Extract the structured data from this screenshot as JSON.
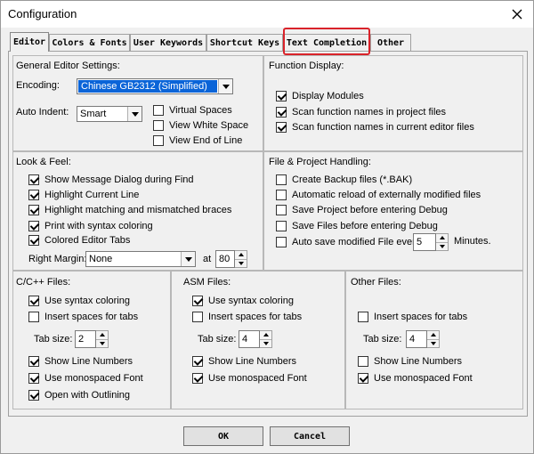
{
  "window": {
    "title": "Configuration"
  },
  "tabs": [
    {
      "label": "Editor",
      "active": true
    },
    {
      "label": "Colors & Fonts"
    },
    {
      "label": "User Keywords"
    },
    {
      "label": "Shortcut Keys"
    },
    {
      "label": "Text Completion",
      "highlighted": true
    },
    {
      "label": "Other"
    }
  ],
  "general": {
    "title": "General Editor Settings:",
    "encoding_label": "Encoding:",
    "encoding_value": "Chinese GB2312 (Simplified)",
    "auto_indent_label": "Auto Indent:",
    "auto_indent_value": "Smart",
    "virtual_spaces": "Virtual Spaces",
    "view_white_space": "View White Space",
    "view_end_of_line": "View End of Line"
  },
  "function_display": {
    "title": "Function Display:",
    "items": [
      "Display Modules",
      "Scan function names in project files",
      "Scan function names in current editor files"
    ]
  },
  "look_feel": {
    "title": "Look & Feel:",
    "items": [
      "Show Message Dialog during Find",
      "Highlight Current Line",
      "Highlight matching and mismatched braces",
      "Print with syntax coloring",
      "Colored Editor Tabs"
    ],
    "right_margin_label": "Right Margin:",
    "right_margin_value": "None",
    "at_label": "at",
    "at_value": "80"
  },
  "file_project": {
    "title": "File & Project Handling:",
    "items": [
      "Create Backup files (*.BAK)",
      "Automatic reload of externally modified files",
      "Save Project before entering Debug",
      "Save Files before entering Debug",
      "Auto save modified File every"
    ],
    "autosave_value": "5",
    "minutes_label": "Minutes."
  },
  "cpp": {
    "title": "C/C++ Files:",
    "use_syntax_coloring": "Use syntax coloring",
    "insert_spaces": "Insert spaces for tabs",
    "tab_size_label": "Tab size:",
    "tab_size_value": "2",
    "show_line_numbers": "Show Line Numbers",
    "use_monospaced": "Use monospaced Font",
    "open_outlining": "Open with Outlining"
  },
  "asm": {
    "title": "ASM Files:",
    "use_syntax_coloring": "Use syntax coloring",
    "insert_spaces": "Insert spaces for tabs",
    "tab_size_label": "Tab size:",
    "tab_size_value": "4",
    "show_line_numbers": "Show Line Numbers",
    "use_monospaced": "Use monospaced Font"
  },
  "other": {
    "title": "Other Files:",
    "insert_spaces": "Insert spaces for tabs",
    "tab_size_label": "Tab size:",
    "tab_size_value": "4",
    "show_line_numbers": "Show Line Numbers",
    "use_monospaced": "Use monospaced Font"
  },
  "buttons": {
    "ok": "OK",
    "cancel": "Cancel"
  },
  "colors": {
    "highlight_border": "#d9232a",
    "selection": "#0a64d8"
  }
}
